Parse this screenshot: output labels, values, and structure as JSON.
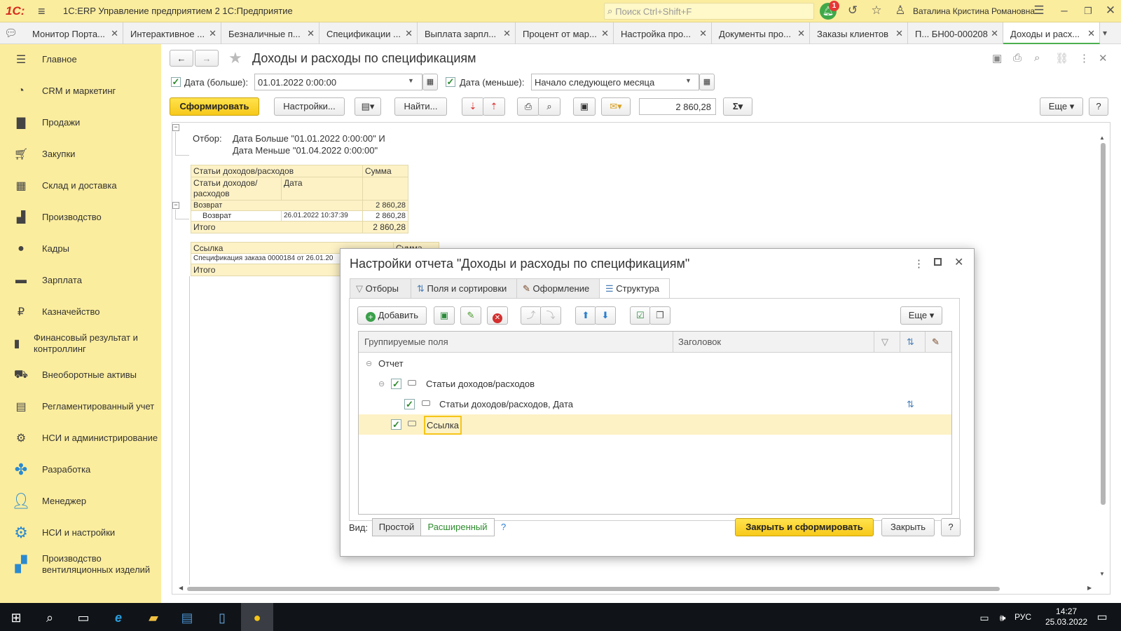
{
  "app": {
    "logo": "1С:",
    "title": "1С:ERP Управление предприятием 2 1С:Предприятие",
    "search_placeholder": "Поиск Ctrl+Shift+F",
    "notification_count": "1",
    "user": "Ваталина Кристина Романовна"
  },
  "open_tabs": [
    {
      "label": "Монитор Порта..."
    },
    {
      "label": "Интерактивное ..."
    },
    {
      "label": "Безналичные п..."
    },
    {
      "label": "Спецификации ..."
    },
    {
      "label": "Выплата зарпл..."
    },
    {
      "label": "Процент от мар..."
    },
    {
      "label": "Настройка про..."
    },
    {
      "label": "Документы про..."
    },
    {
      "label": "Заказы клиентов"
    },
    {
      "label": "П...   БН00-000208"
    },
    {
      "label": "Доходы и расх..."
    }
  ],
  "sidebar": {
    "items": [
      {
        "label": "Главное",
        "icon": "menu-icon"
      },
      {
        "label": "CRM и маркетинг",
        "icon": "pie-chart-icon"
      },
      {
        "label": "Продажи",
        "icon": "shopping-bag-icon"
      },
      {
        "label": "Закупки",
        "icon": "cart-icon"
      },
      {
        "label": "Склад и доставка",
        "icon": "warehouse-icon"
      },
      {
        "label": "Производство",
        "icon": "factory-icon"
      },
      {
        "label": "Кадры",
        "icon": "person-icon"
      },
      {
        "label": "Зарплата",
        "icon": "wallet-icon"
      },
      {
        "label": "Казначейство",
        "icon": "ruble-icon"
      },
      {
        "label": "Финансовый результат и контроллинг",
        "icon": "bar-chart-icon"
      },
      {
        "label": "Внеоборотные активы",
        "icon": "truck-icon"
      },
      {
        "label": "Регламентированный учет",
        "icon": "document-icon"
      },
      {
        "label": "НСИ и администрирование",
        "icon": "gear-icon"
      },
      {
        "label": "Разработка",
        "icon": "puzzle-icon"
      },
      {
        "label": "Менеджер",
        "icon": "person-icon"
      },
      {
        "label": "НСИ и настройки",
        "icon": "gears-icon"
      },
      {
        "label": "Производство вентиляционных изделий",
        "icon": "factory-icon"
      }
    ]
  },
  "page": {
    "title": "Доходы и расходы по спецификациям",
    "date_from_label": "Дата (больше):",
    "date_from_value": "01.01.2022  0:00:00",
    "date_to_label": "Дата (меньше):",
    "date_to_value": "Начало следующего месяца",
    "generate_button": "Сформировать",
    "settings_button": "Настройки...",
    "find_button": "Найти...",
    "sum_value": "2 860,28",
    "more_button": "Еще",
    "help_button": "?"
  },
  "report": {
    "filter_label": "Отбор:",
    "filter_line1": "Дата Больше \"01.01.2022 0:00:00\" И",
    "filter_line2": "Дата Меньше \"01.04.2022 0:00:00\"",
    "t1_header_col1": "Статьи доходов/расходов",
    "t1_header_col2": "Сумма",
    "t1_sub_col1": "Статьи доходов/расходов",
    "t1_sub_col2": "Дата",
    "t1_group_label": "Возврат",
    "t1_group_sum": "2 860,28",
    "t1_row_label": "Возврат",
    "t1_row_date": "26.01.2022 10:37:39",
    "t1_row_sum": "2 860,28",
    "t1_total_label": "Итого",
    "t1_total_sum": "2 860,28",
    "t2_header_col1": "Ссылка",
    "t2_header_col2": "Сумма",
    "t2_row_label": "Спецификация заказа 0000184 от 26.01.20",
    "t2_total_label": "Итого"
  },
  "dialog": {
    "title": "Настройки отчета \"Доходы и расходы по спецификациям\"",
    "tabs": [
      {
        "label": "Отборы"
      },
      {
        "label": "Поля и сортировки"
      },
      {
        "label": "Оформление"
      },
      {
        "label": "Структура"
      }
    ],
    "add_button": "Добавить",
    "more_button": "Еще",
    "col_grouped_fields": "Группируемые поля",
    "col_heading": "Заголовок",
    "tree": {
      "root": "Отчет",
      "node1": "Статьи доходов/расходов",
      "node2": "Статьи доходов/расходов, Дата",
      "node3": "Ссылка"
    },
    "view_label": "Вид:",
    "view_simple": "Простой",
    "view_extended": "Расширенный",
    "view_help": "?",
    "close_and_generate": "Закрыть и сформировать",
    "close": "Закрыть",
    "help": "?"
  },
  "taskbar": {
    "lang": "РУС",
    "time": "14:27",
    "date": "25.03.2022"
  }
}
